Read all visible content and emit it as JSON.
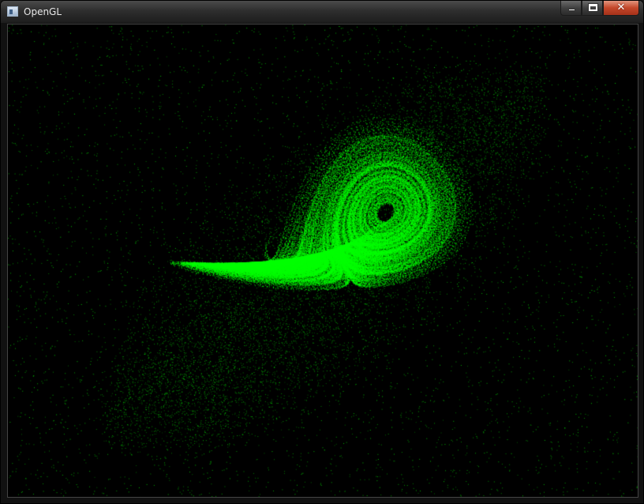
{
  "window": {
    "title": "OpenGL",
    "icon": "app-window-icon",
    "controls": {
      "minimize_icon": "minimize-icon",
      "maximize_icon": "maximize-icon",
      "close_icon": "close-icon",
      "close_glyph": "✕"
    }
  },
  "viewport": {
    "background": "#000000",
    "point_color": "#00ff00",
    "content": "lorenz-attractor-point-cloud"
  }
}
